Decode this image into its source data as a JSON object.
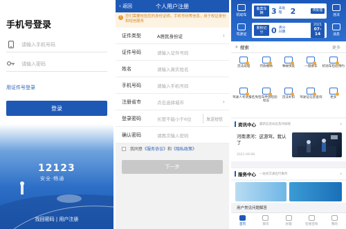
{
  "login": {
    "title": "手机号登录",
    "phone_placeholder": "请输入手机号码",
    "password_placeholder": "请输入密码",
    "id_login_link": "用证件号登录",
    "login_button": "登录",
    "logo_text": "12123",
    "slogan": "安全·畅通",
    "bottom_links": "找回密码 | 用户注册"
  },
  "register": {
    "back_label": "返回",
    "title": "个人用户注册",
    "notice": "您们需要校验您的身份证明，手机号码等信息，用于校证身份和短信服务",
    "fields": [
      {
        "label": "证件类型",
        "value": "A居民身份证",
        "chevron": true
      },
      {
        "label": "证件号码",
        "value": "请输入证件号码"
      },
      {
        "label": "姓名",
        "value": "请输入真实姓名"
      },
      {
        "label": "手机号码",
        "value": "请输入手机号码"
      },
      {
        "label": "注册省市",
        "value": "点击选择城市",
        "chevron": true
      },
      {
        "label": "登录密码",
        "value": "长度不能小于6位",
        "action": "发送短信"
      },
      {
        "label": "确认密码",
        "value": "请再次输入密码"
      }
    ],
    "agree_prefix": "我同意",
    "agree_link1": "《服务协议》",
    "agree_and": "和",
    "agree_link2": "《隐私政策》",
    "next_button": "下一步"
  },
  "home": {
    "top_left_icon1": "机动车",
    "top_left_icon2": "驾驶证",
    "top_right_icon1": "违法",
    "top_right_icon2": "消息",
    "card1": {
      "plate": "备案车辆",
      "count": "3",
      "label1": "未处",
      "label2": "理",
      "count2": "2",
      "end": "待处理"
    },
    "card2": {
      "plate": "累积记分",
      "count": "0",
      "label1": "清分",
      "label2": "日期",
      "year": "2021",
      "date": "07-14"
    },
    "search_label": "搜索",
    "more_label": "更多",
    "grid_items": [
      "违法处理",
      "罚款缴纳",
      "事故快处",
      "一键挪车",
      "机动车检验预约",
      "驾驶人考试报名",
      "免检车申领检验标志",
      "违法补扣",
      "驾驶证信息查询",
      "更多"
    ],
    "news_header": "资讯中心",
    "news_sub": "最新信息动态及时知晓",
    "news_title": "河南漯河：这游驾，我认了",
    "news_date": "2021-09-08",
    "service_header": "服务中心",
    "service_sub": "一站式交通出行服务",
    "qa_label": "用户常见问题解答",
    "tabs": [
      "首页",
      "资讯",
      "办理",
      "在线咨询",
      "我的"
    ]
  },
  "colors": {
    "primary": "#1e58b5",
    "notice": "#d98a2a",
    "accent": "#f0a634"
  }
}
